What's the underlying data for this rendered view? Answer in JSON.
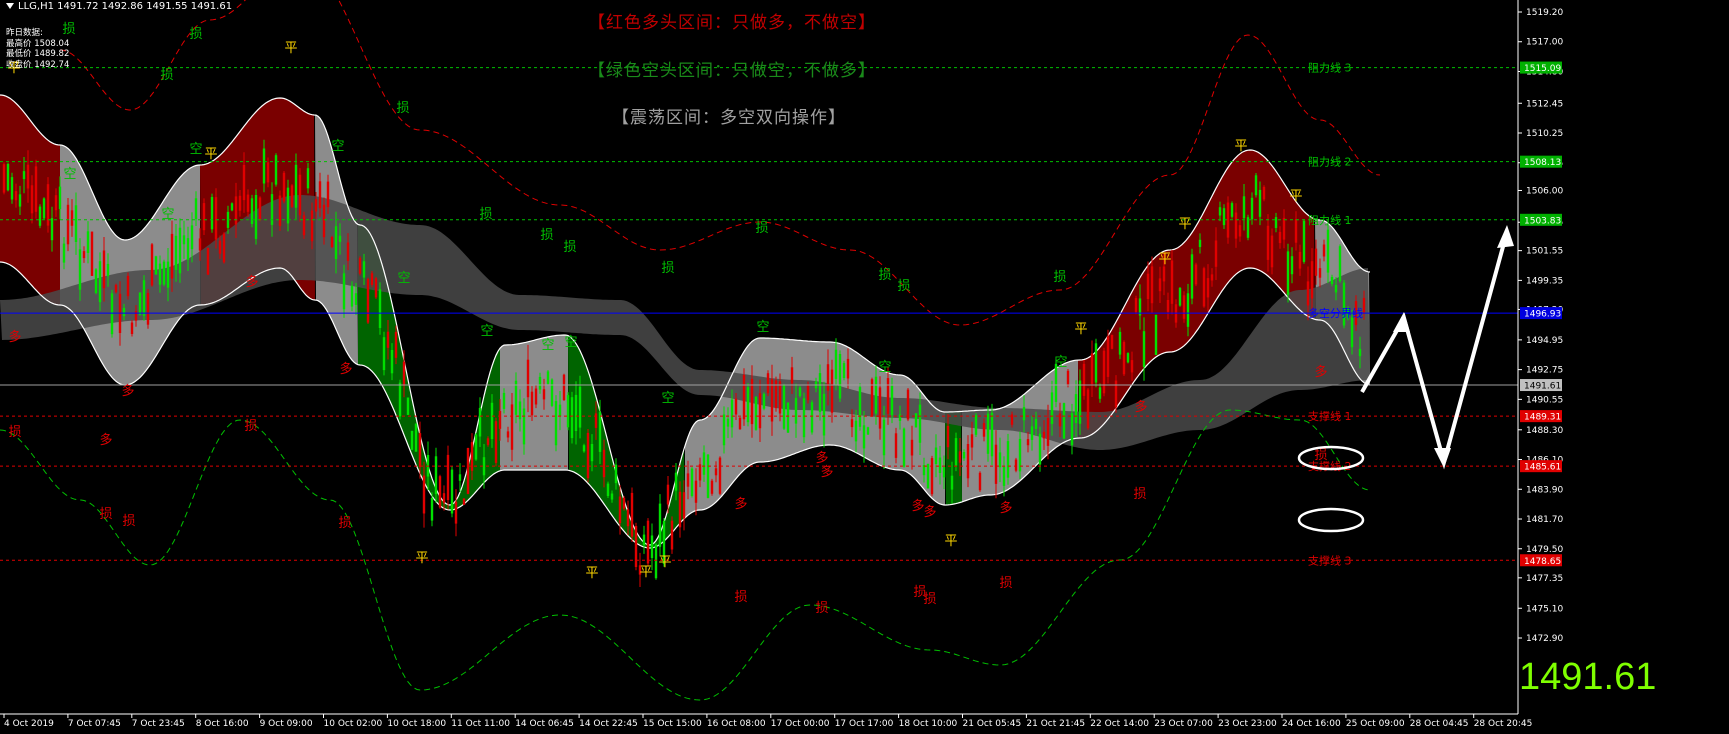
{
  "header": {
    "symbol_line": "LLG,H1  1491.72 1492.86 1491.55 1491.61"
  },
  "info": {
    "lines": [
      "昨日数据:",
      "最高价 1508.04",
      "最低价 1489.82",
      "收盘价 1492.74"
    ]
  },
  "banners": [
    {
      "text": "【红色多头区间：只做多，不做空】",
      "color": "#c00000"
    },
    {
      "text": "【绿色空头区间：只做空，不做多】",
      "color": "#1a8a1a"
    },
    {
      "text": "【震荡区间：多空双向操作】",
      "color": "#a0a0a0"
    }
  ],
  "current_price": "1491.61",
  "price_scale": [
    "1519.20",
    "1517.00",
    "1514.80",
    "1512.45",
    "1510.25",
    "1508.05",
    "1506.00",
    "1503.65",
    "1501.55",
    "1499.35",
    "1497.20",
    "1494.95",
    "1492.75",
    "1490.55",
    "1488.30",
    "1486.10",
    "1483.90",
    "1481.70",
    "1479.50",
    "1477.35",
    "1475.10",
    "1472.90"
  ],
  "price_badges": [
    {
      "text": "1515.09",
      "bg": "#00b000",
      "fg": "#ffffff"
    },
    {
      "text": "1508.13",
      "bg": "#00b000",
      "fg": "#ffffff"
    },
    {
      "text": "1503.83",
      "bg": "#00b000",
      "fg": "#ffffff"
    },
    {
      "text": "1496.93",
      "bg": "#0000e0",
      "fg": "#ffffff"
    },
    {
      "text": "1491.61",
      "bg": "#c0c0c0",
      "fg": "#000000"
    },
    {
      "text": "1489.31",
      "bg": "#e00000",
      "fg": "#ffffff"
    },
    {
      "text": "1485.61",
      "bg": "#e00000",
      "fg": "#ffffff"
    },
    {
      "text": "1478.65",
      "bg": "#e00000",
      "fg": "#ffffff"
    }
  ],
  "time_axis": [
    "4 Oct 2019",
    "7 Oct 07:45",
    "7 Oct 23:45",
    "8 Oct 16:00",
    "9 Oct 09:00",
    "10 Oct 02:00",
    "10 Oct 18:00",
    "11 Oct 11:00",
    "14 Oct 06:45",
    "14 Oct 22:45",
    "15 Oct 15:00",
    "16 Oct 08:00",
    "17 Oct 00:00",
    "17 Oct 17:00",
    "18 Oct 10:00",
    "21 Oct 05:45",
    "21 Oct 21:45",
    "22 Oct 14:00",
    "23 Oct 07:00",
    "23 Oct 23:00",
    "24 Oct 16:00",
    "25 Oct 09:00",
    "28 Oct 04:45",
    "28 Oct 20:45"
  ],
  "level_labels": {
    "resistance_3": "阻力线 3",
    "resistance_2": "阻力线 2",
    "resistance_1": "阻力线 1",
    "divider": "多空分界线",
    "support_1": "支撑线 1",
    "support_2": "支撑线 2",
    "support_3": "支撑线 3"
  },
  "marks": {
    "flat": "平",
    "short": "空",
    "long": "多",
    "stop": "损"
  },
  "colors": {
    "bull_zone": "#7a0000",
    "bear_zone": "#006400",
    "range_zone": "#8c8c8c",
    "band_dark": "#4a4a4a",
    "candle": "#00e000",
    "candle_bear": "#e00000",
    "resistance": "#00c000",
    "divider": "#0000ff",
    "support": "#e00000",
    "price_line": "#a0a0a0",
    "mark_flat": "#ffd700",
    "mark_green": "#00c000",
    "mark_red": "#e00000"
  }
}
